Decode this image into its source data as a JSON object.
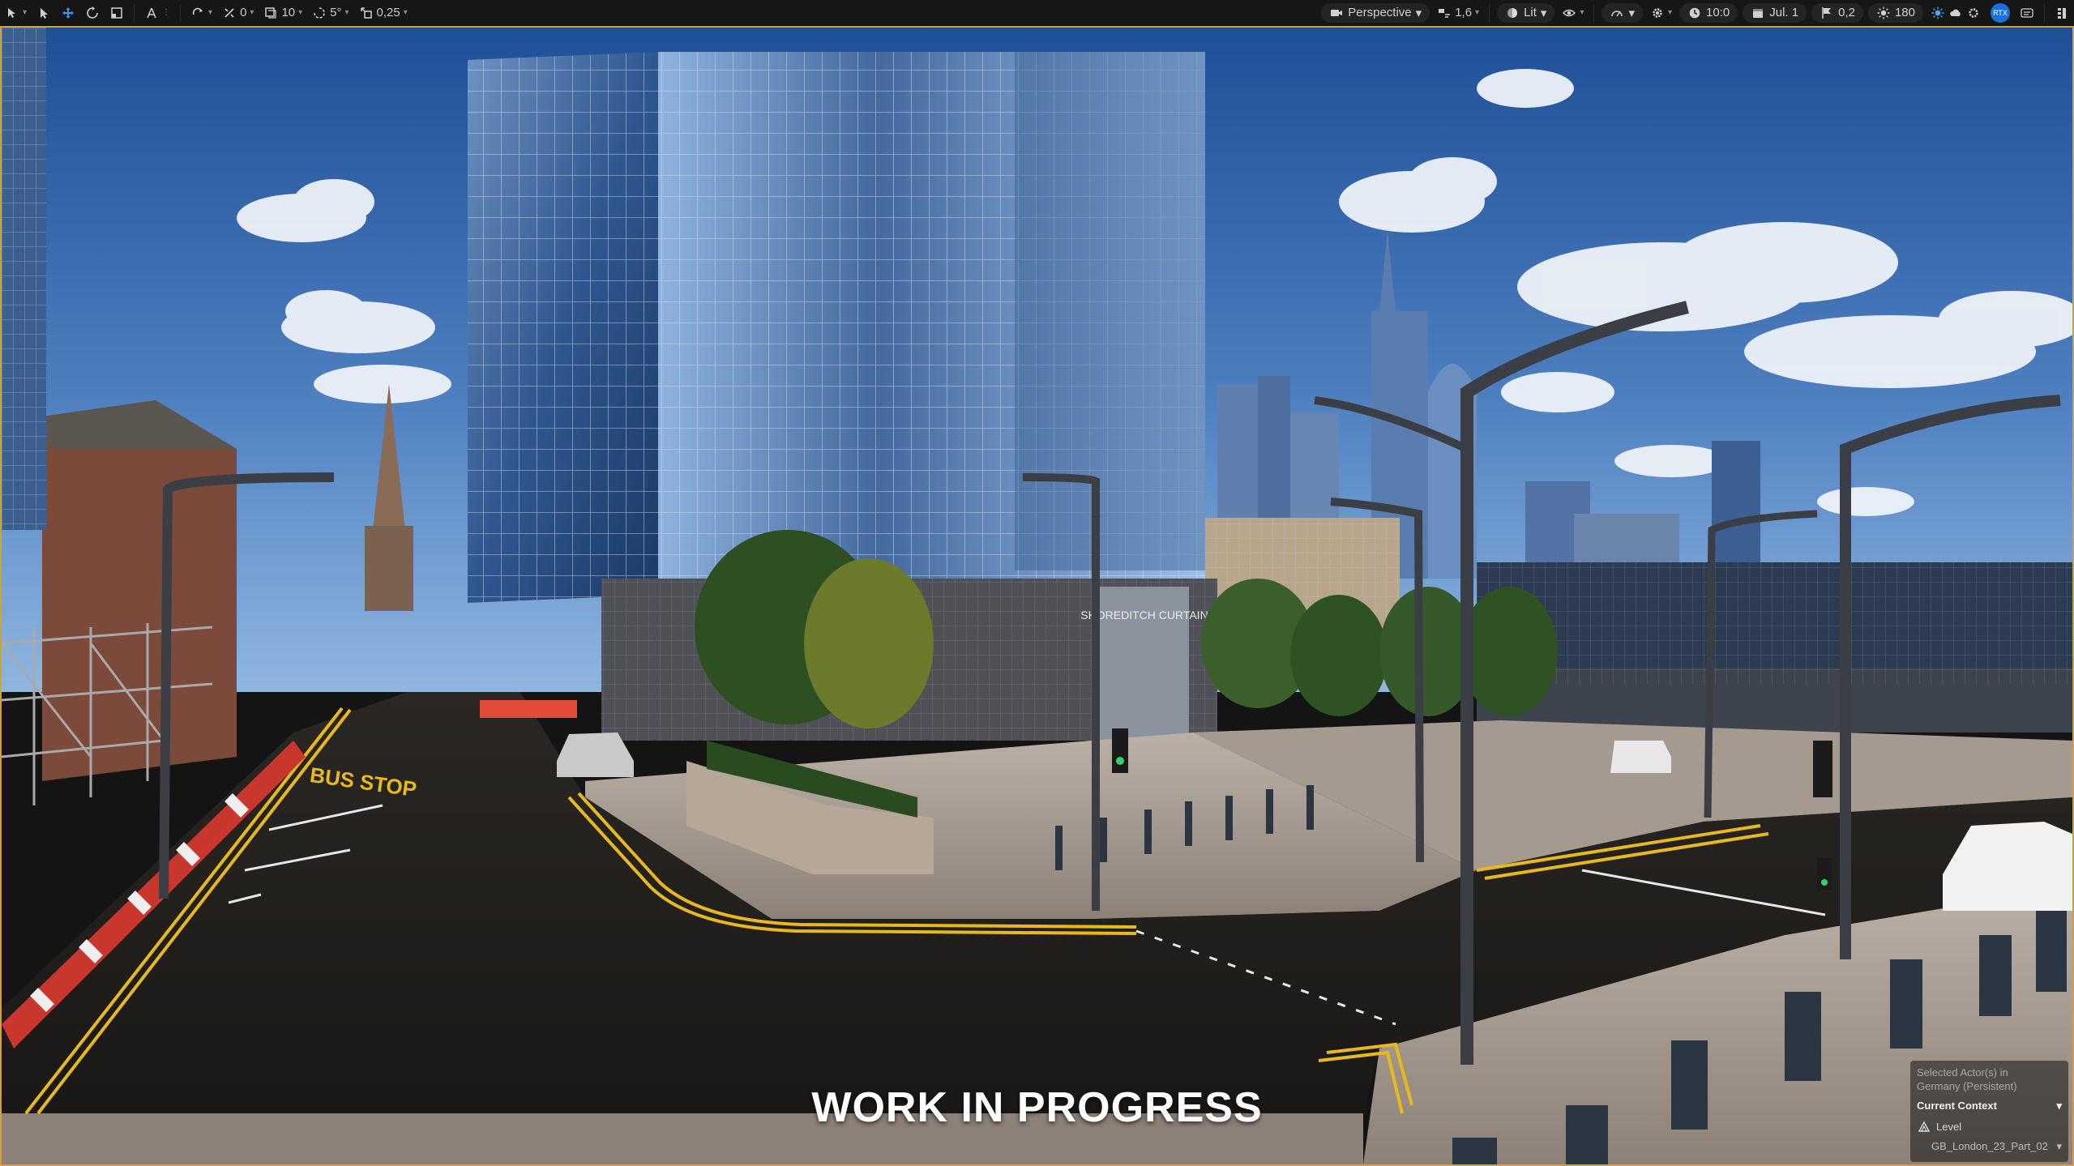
{
  "toolbar": {
    "snap_translate": "0",
    "snap_grid": "10",
    "snap_rotate": "5°",
    "snap_scale": "0,25",
    "view_mode": "Perspective",
    "camera_speed": "1,6",
    "lighting_mode": "Lit",
    "time_of_day": "10:0",
    "date": "Jul. 1",
    "cloud_value": "0,2",
    "sun_value": "180",
    "rt_badge": "RTX"
  },
  "viewport": {
    "overlay_text": "WORK IN PROGRESS",
    "scene_signage": {
      "road_marking": "BUS STOP",
      "station_sign": "SHOREDITCH CURTAIN"
    }
  },
  "actor_panel": {
    "selected_label": "Selected Actor(s) in",
    "selected_world": "Germany (Persistent)",
    "current_context": "Current Context",
    "context_type": "Level",
    "level_name": "GB_London_23_Part_02"
  },
  "colors": {
    "viewport_border": "#d6a12a",
    "accent_blue": "#2e9bff",
    "sky_top": "#1f4f96",
    "sky_bottom": "#8fb6e0",
    "asphalt": "#1e1c1a",
    "yellow_line": "#e8b91f"
  }
}
